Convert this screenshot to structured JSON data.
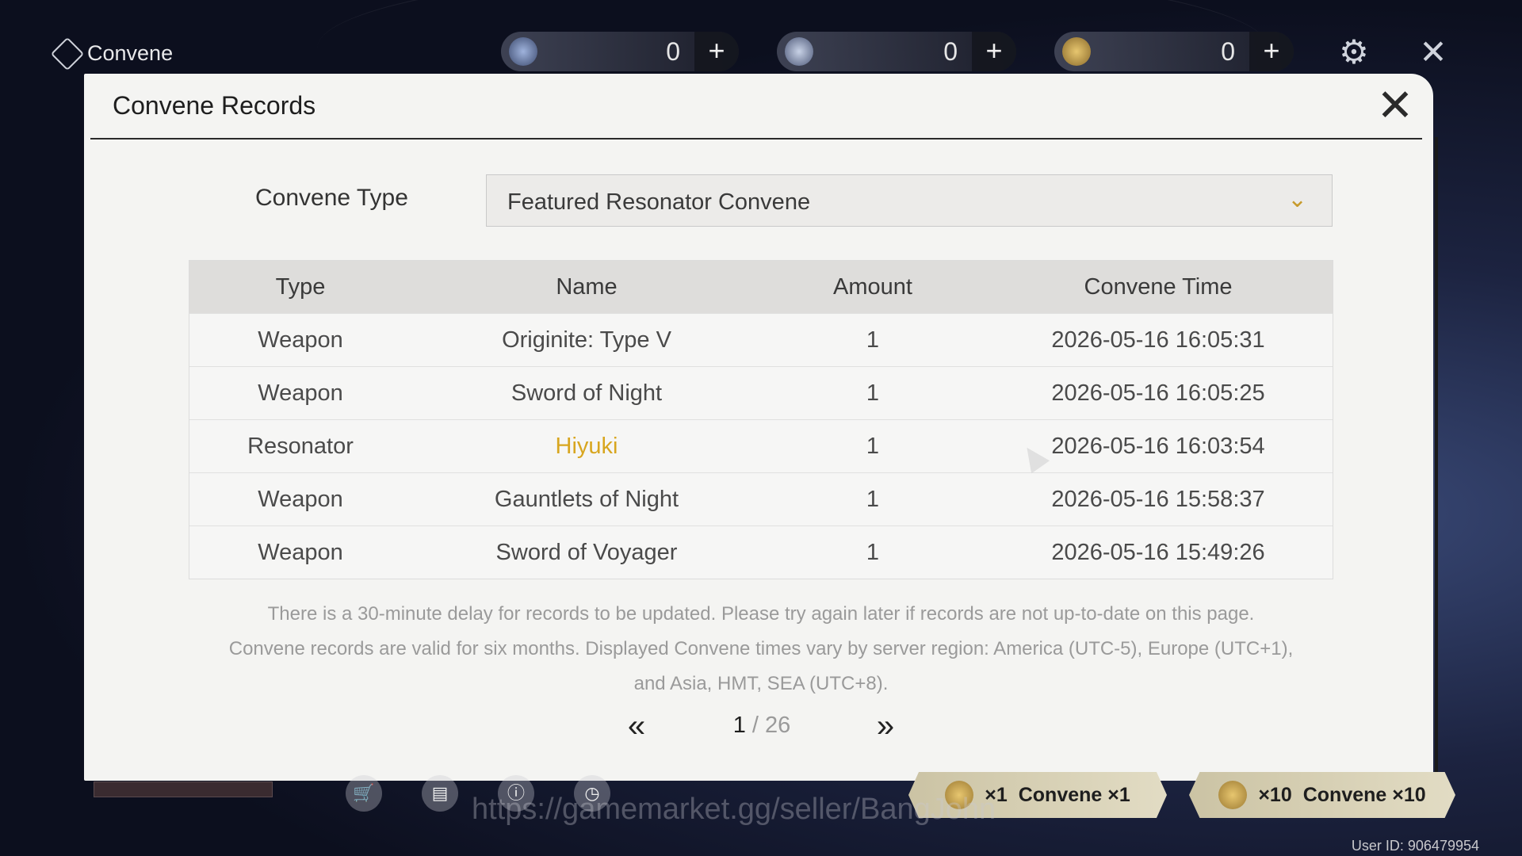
{
  "topbar": {
    "title": "Convene",
    "currencies": [
      {
        "name": "astrite",
        "value": "0",
        "plus": "+",
        "color": "#6a7fa8"
      },
      {
        "name": "lunite",
        "value": "0",
        "plus": "+",
        "color": "#5d6a86"
      },
      {
        "name": "tide",
        "value": "0",
        "plus": "+",
        "color": "#b5954e"
      }
    ],
    "icons": {
      "settings": "gear-icon",
      "exit": "close-icon"
    }
  },
  "modal": {
    "title": "Convene Records",
    "close_glyph": "✕",
    "type_label": "Convene Type",
    "selected_type": "Featured Resonator Convene",
    "chevron_glyph": "⌄",
    "columns": [
      "Type",
      "Name",
      "Amount",
      "Convene Time"
    ],
    "rows": [
      {
        "type": "Weapon",
        "name": "Originite: Type V",
        "amount": "1",
        "time": "2026-05-16 16:05:31"
      },
      {
        "type": "Weapon",
        "name": "Sword of Night",
        "amount": "1",
        "time": "2026-05-16 16:05:25"
      },
      {
        "type": "Resonator",
        "name": "Hiyuki",
        "amount": "1",
        "time": "2026-05-16 16:03:54"
      },
      {
        "type": "Weapon",
        "name": "Gauntlets of Night",
        "amount": "1",
        "time": "2026-05-16 15:58:37"
      },
      {
        "type": "Weapon",
        "name": "Sword of Voyager",
        "amount": "1",
        "time": "2026-05-16 15:49:26"
      }
    ],
    "highlight_color": "#d8a61f",
    "notice_line1": "There is a 30-minute delay for records to be updated. Please try again later if records are not up-to-date on this page.",
    "notice_line2": "Convene records are valid for six months. Displayed Convene times vary by server region: America (UTC-5), Europe (UTC+1),",
    "notice_line3": "and Asia, HMT, SEA (UTC+8).",
    "pager": {
      "prev": "«",
      "next": "»",
      "current": "1",
      "separator": " / ",
      "total": "26"
    }
  },
  "bottombar": {
    "convene_single": {
      "count": "×1",
      "label": "Convene ×1"
    },
    "convene_multi": {
      "count": "×10",
      "label": "Convene ×10"
    },
    "watermark": "https://gamemarket.gg/seller/BangJohn",
    "user_id": "User ID: 906479954"
  }
}
